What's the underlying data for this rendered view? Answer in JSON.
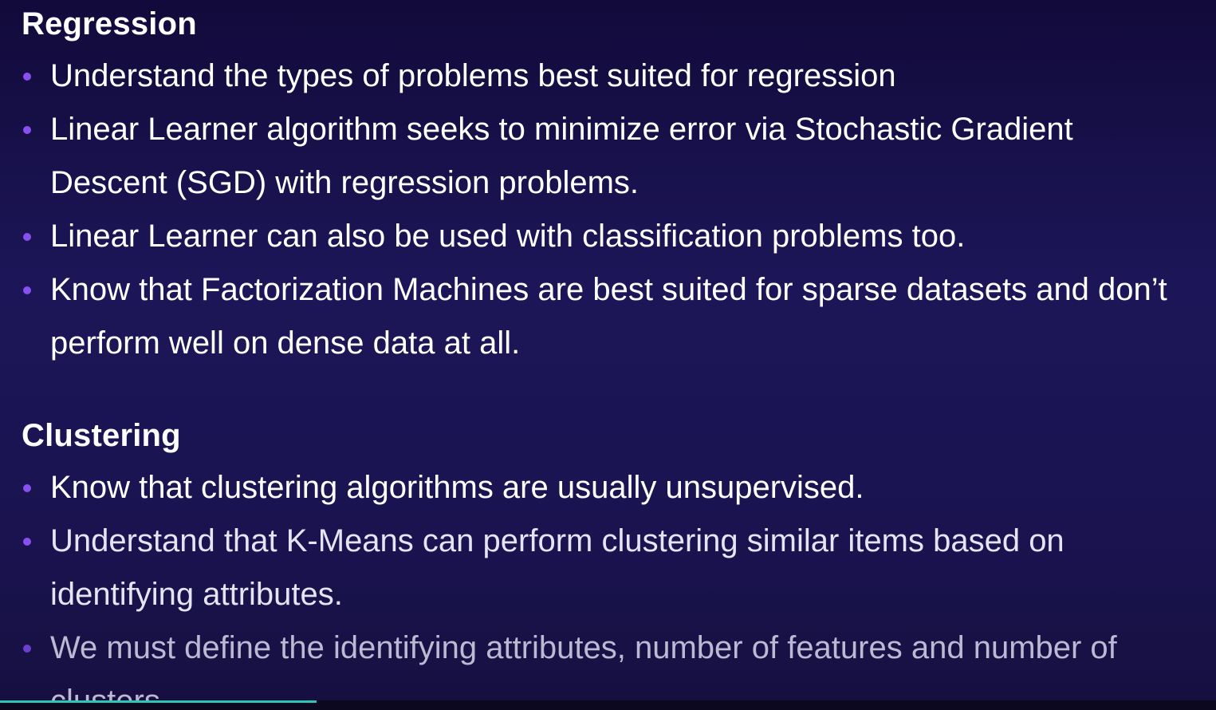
{
  "sections": [
    {
      "heading": "Regression",
      "items": [
        "Understand the types of problems best suited for regression",
        "Linear Learner algorithm seeks to minimize error via Stochastic Gradient Descent (SGD) with regression problems.",
        "Linear Learner can also be used with classification problems too.",
        "Know that Factorization Machines are best suited for sparse datasets and don’t perform well on dense data at all."
      ]
    },
    {
      "heading": "Clustering",
      "items": [
        "Know that clustering algorithms are usually unsupervised.",
        "Understand that K-Means can perform clustering similar items based on identifying attributes.",
        "We must define the identifying attributes, number of features and number of clusters."
      ]
    }
  ],
  "colors": {
    "bullet": "#8a4ff0",
    "progress": "#2ec4b6"
  },
  "video_progress": 0.26
}
